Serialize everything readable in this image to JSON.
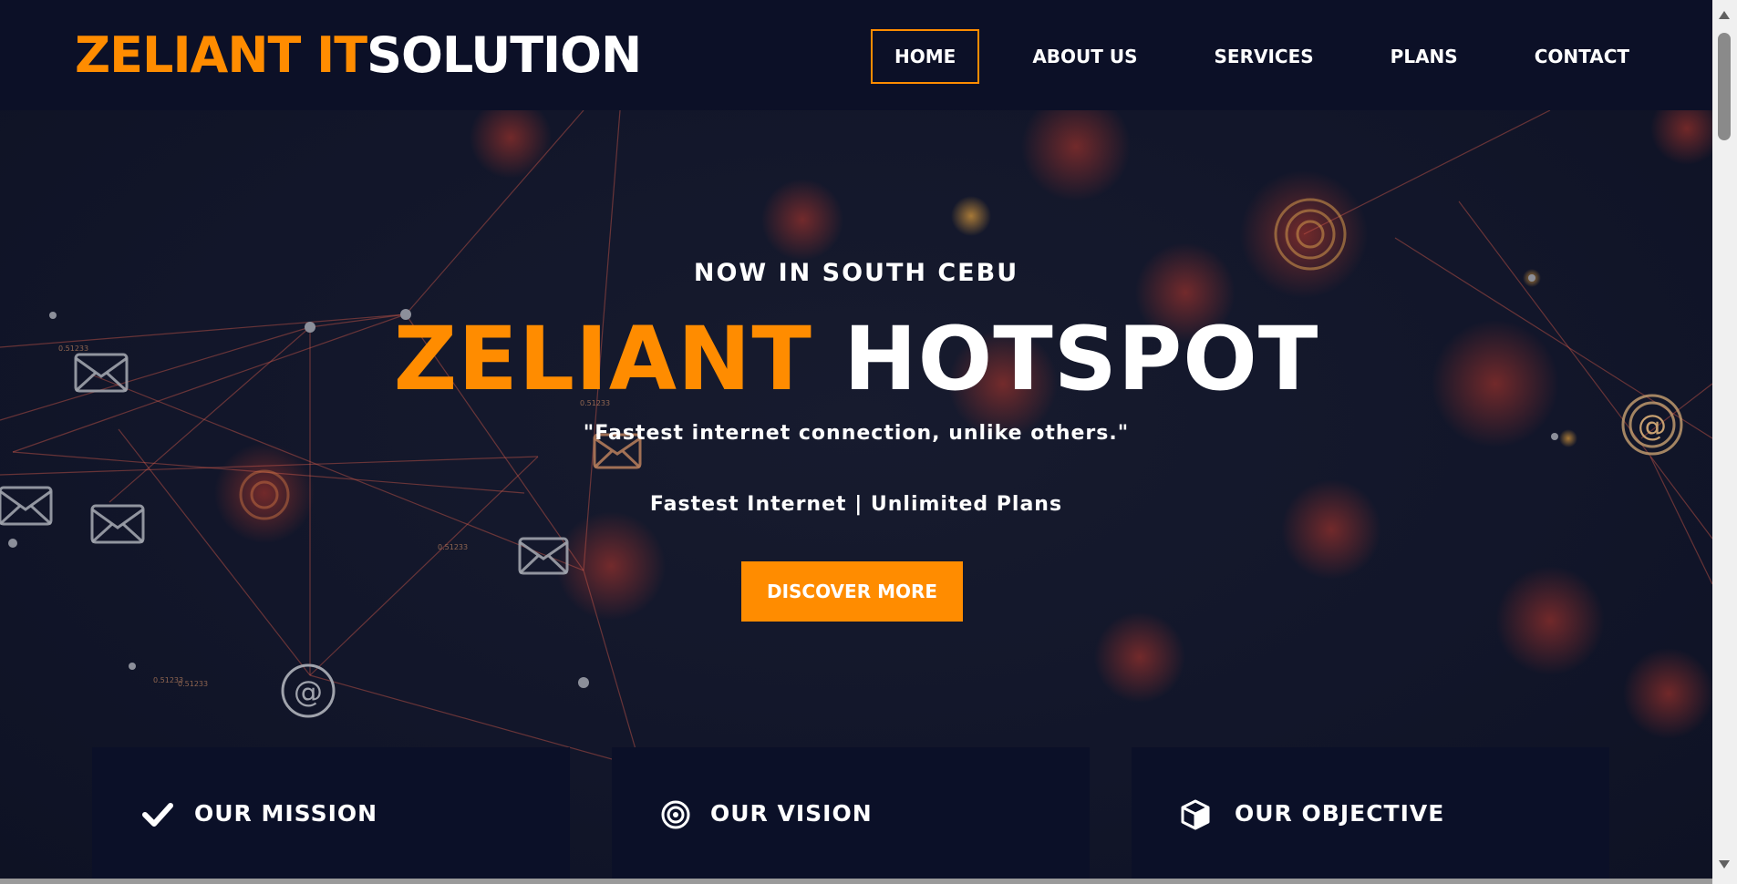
{
  "header": {
    "logo_part1": "ZELIANT IT",
    "logo_part2": "SOLUTION",
    "nav": [
      {
        "label": "HOME",
        "active": true
      },
      {
        "label": "ABOUT US",
        "active": false
      },
      {
        "label": "SERVICES",
        "active": false
      },
      {
        "label": "PLANS",
        "active": false
      },
      {
        "label": "CONTACT",
        "active": false
      }
    ]
  },
  "hero": {
    "eyebrow": "NOW IN SOUTH CEBU",
    "title_part1": "ZELIANT",
    "title_part2": "HOTSPOT",
    "quote": "\"Fastest internet connection, unlike others.\"",
    "tagline": "Fastest Internet | Unlimited Plans",
    "cta_label": "DISCOVER MORE",
    "background_labels": [
      "0.51233",
      "0.51233",
      "0.51233",
      "0.51233",
      "0.51233"
    ]
  },
  "cards": [
    {
      "icon": "checkmark-icon",
      "title": "OUR MISSION"
    },
    {
      "icon": "target-icon",
      "title": "OUR VISION"
    },
    {
      "icon": "cube-icon",
      "title": "OUR OBJECTIVE"
    }
  ],
  "colors": {
    "accent": "#ff8c00",
    "header_bg": "#0c1027",
    "card_bg": "#0b1028",
    "text": "#ffffff"
  }
}
